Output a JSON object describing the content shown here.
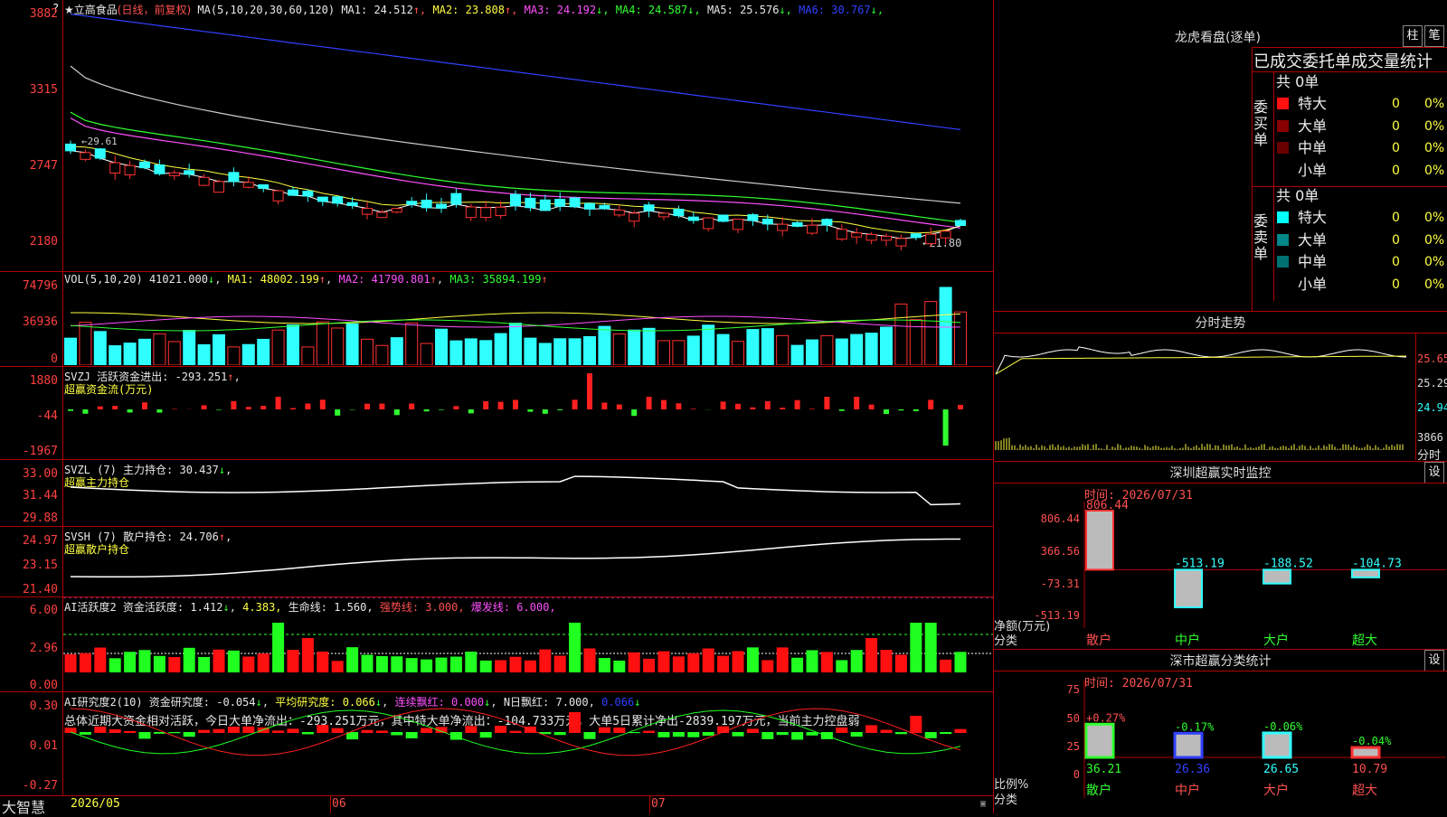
{
  "stock": {
    "name": "★立高食品",
    "mode": "(日线，前复权)",
    "ma_prefix": "MA(5,10,20,30,60,120)",
    "ma": [
      {
        "label": "MA1:",
        "value": "24.512",
        "arrow": "↑",
        "color": "#e8e8e8"
      },
      {
        "label": "MA2:",
        "value": "23.808",
        "arrow": "↑",
        "color": "#ffff40"
      },
      {
        "label": "MA3:",
        "value": "24.192",
        "arrow": "↓",
        "color": "#ff50ff"
      },
      {
        "label": "MA4:",
        "value": "24.587",
        "arrow": "↓",
        "color": "#30ff30"
      },
      {
        "label": "MA5:",
        "value": "25.576",
        "arrow": "↓",
        "color": "#e8e8e8"
      },
      {
        "label": "MA6:",
        "value": "30.767",
        "arrow": "↓",
        "color": "#3040ff"
      }
    ],
    "price_axis": [
      "3882",
      "3315",
      "2747",
      "2180"
    ],
    "low_note": "←21.80",
    "high_note": "←29.61"
  },
  "vol": {
    "line": "VOL(5,10,20)",
    "value": "41021.000",
    "arrow": "↓",
    "ma1": "MA1: 48002.199",
    "ma1_arrow": "↑",
    "ma2": "MA2: 41790.801",
    "ma2_arrow": "↑",
    "ma3": "MA3: 35894.199",
    "ma3_arrow": "↑",
    "axis": [
      "74796",
      "36936",
      "0"
    ]
  },
  "svzj": {
    "line1": "SVZJ  活跃资金进出: -293.251",
    "arrow": "↑",
    "line2": "超赢资金流(万元)",
    "axis": [
      "1880",
      "-44",
      "-1967"
    ]
  },
  "svzl": {
    "line1": "SVZL (7) 主力持仓: 30.437",
    "arrow": "↓",
    "tail": ",",
    "line2": "超赢主力持仓",
    "axis": [
      "33.00",
      "31.44",
      "29.88"
    ]
  },
  "svsh": {
    "line1": "SVSH (7) 散户持仓: 24.706",
    "arrow": "↑",
    "tail": ",",
    "line2": "超赢散户持仓",
    "axis": [
      "24.97",
      "23.15",
      "21.40"
    ]
  },
  "ai2": {
    "a": "AI活跃度2 资金活跃度: 1.412",
    "a_arrow": "↓",
    "b": "4.383,",
    "c": "生命线: 1.560,",
    "d": "强势线: 3.000,",
    "e": "爆发线: 6.000,",
    "axis": [
      "6.00",
      "2.96",
      "0.00"
    ]
  },
  "ai3": {
    "a": "AI研究度2(10) 资金研究度: -0.054",
    "a_arrow": "↓",
    "b": "平均研究度: 0.066",
    "b_arrow": "↓",
    "c": "连续飘红: 0.000",
    "c_arrow": "↓",
    "d": "N日飘红: 7.000,",
    "e": "0.066",
    "e_arrow": "↓",
    "summary": "总体近期大资金相对活跃，今日大单净流出：-293.251万元，其中特大单净流出：-104.733万元，大单5日累计净出-2839.197万元，当前主力控盘弱",
    "axis": [
      "0.30",
      "0.01",
      "-0.27"
    ]
  },
  "bottom": {
    "logo": "大智慧",
    "dates": [
      "2026/05",
      "06",
      "07"
    ]
  },
  "panel": {
    "title": "龙虎看盘(逐单)",
    "btn1": "柱",
    "btn2": "笔",
    "subtitle": "已成交委托单成交量统计",
    "buy": {
      "side": "委买单",
      "total": "共 0单",
      "rows": [
        {
          "label": "特大",
          "count": "0",
          "pct": "0%",
          "color": "#ff1010"
        },
        {
          "label": "大单",
          "count": "0",
          "pct": "0%",
          "color": "#880000"
        },
        {
          "label": "中单",
          "count": "0",
          "pct": "0%",
          "color": "#6a0000"
        },
        {
          "label": "小单",
          "count": "0",
          "pct": "0%",
          "color": "#000000"
        }
      ]
    },
    "sell": {
      "side": "委卖单",
      "total": "共 0单",
      "rows": [
        {
          "label": "特大",
          "count": "0",
          "pct": "0%",
          "color": "#00ffff"
        },
        {
          "label": "大单",
          "count": "0",
          "pct": "0%",
          "color": "#008888"
        },
        {
          "label": "中单",
          "count": "0",
          "pct": "0%",
          "color": "#007070"
        },
        {
          "label": "小单",
          "count": "0",
          "pct": "0%",
          "color": "#000000"
        }
      ]
    },
    "intraday": {
      "title": "分时走势",
      "axis": [
        "25.65",
        "25.29",
        "24.94"
      ],
      "vol_label": "3866",
      "vol_unit": "分时"
    },
    "monitor": {
      "title": "深圳超赢实时监控",
      "btn": "设",
      "time": "时间: 2026/07/31",
      "axis": [
        "806.44",
        "366.56",
        "-73.31",
        "-513.19"
      ],
      "ylabel": "净额(万元)",
      "xlabel": "分类",
      "bars": [
        {
          "cat": "散户",
          "label": "806.44",
          "value": 806.44
        },
        {
          "cat": "中户",
          "label": "-513.19",
          "value": -513.19
        },
        {
          "cat": "大户",
          "label": "-188.52",
          "value": -188.52
        },
        {
          "cat": "超大",
          "label": "-104.73",
          "value": -104.73
        }
      ]
    },
    "classify": {
      "title": "深市超赢分类统计",
      "btn": "设",
      "time": "时间: 2026/07/31",
      "axis": [
        "75",
        "50",
        "25",
        "0"
      ],
      "ylabel": "比例%",
      "xlabel": "分类",
      "bars": [
        {
          "cat": "散户",
          "pct": 36.21,
          "pct_label": "36.21",
          "delta": "+0.27%"
        },
        {
          "cat": "中户",
          "pct": 26.36,
          "pct_label": "26.36",
          "delta": "-0.17%"
        },
        {
          "cat": "大户",
          "pct": 26.65,
          "pct_label": "26.65",
          "delta": "-0.06%"
        },
        {
          "cat": "超大",
          "pct": 10.79,
          "pct_label": "10.79",
          "delta": "-0.04%"
        }
      ]
    }
  }
}
